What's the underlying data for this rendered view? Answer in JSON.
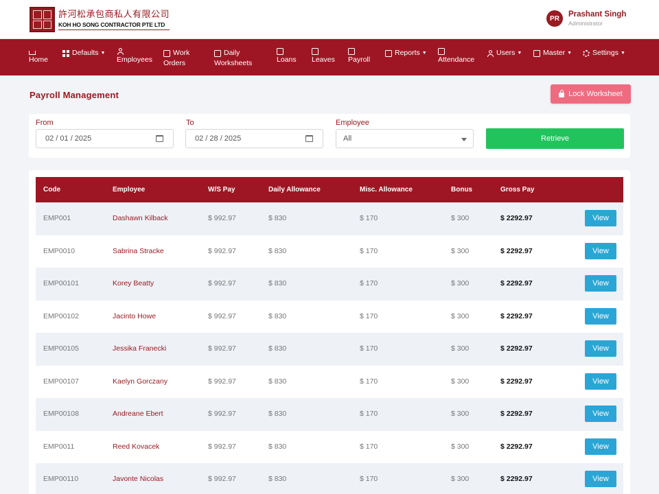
{
  "brand": {
    "name_cn": "許河松承包商私人有限公司",
    "name_en": "KOH HO SONG CONTRACTOR PTE LTD"
  },
  "user": {
    "initials": "PR",
    "name": "Prashant Singh",
    "role": "Administrator"
  },
  "nav": {
    "items": [
      {
        "line1": "Home",
        "line2": "",
        "icon": "home-icon"
      },
      {
        "line1": "Defaults",
        "line2": "",
        "icon": "grid-icon",
        "dropdown": true
      },
      {
        "line1": "",
        "line2": "Employees",
        "icon": "person-icon"
      },
      {
        "line1": "Work",
        "line2": "Orders",
        "icon": "briefcase-icon"
      },
      {
        "line1": "Daily",
        "line2": "Worksheets",
        "icon": "calendar-icon"
      },
      {
        "line1": "",
        "line2": "Loans",
        "icon": "money-icon"
      },
      {
        "line1": "",
        "line2": "Leaves",
        "icon": "calendar-icon"
      },
      {
        "line1": "",
        "line2": "Payroll",
        "icon": "payroll-icon"
      },
      {
        "line1": "Reports",
        "line2": "",
        "icon": "report-icon",
        "dropdown": true
      },
      {
        "line1": "",
        "line2": "Attendance",
        "icon": "attendance-icon"
      },
      {
        "line1": "Users",
        "line2": "",
        "icon": "users-icon",
        "dropdown": true
      },
      {
        "line1": "Master",
        "line2": "",
        "icon": "database-icon",
        "dropdown": true
      },
      {
        "line1": "Settings",
        "line2": "",
        "icon": "gear-icon",
        "dropdown": true
      }
    ]
  },
  "page": {
    "title": "Payroll Management",
    "lock_button": "Lock Worksheet"
  },
  "filters": {
    "from_label": "From",
    "from_value": "02 / 01 / 2025",
    "to_label": "To",
    "to_value": "02 / 28 / 2025",
    "employee_label": "Employee",
    "employee_value": "All",
    "retrieve_button": "Retrieve"
  },
  "table": {
    "headers": [
      "Code",
      "Employee",
      "W/S Pay",
      "Daily Allowance",
      "Misc. Allowance",
      "Bonus",
      "Gross Pay"
    ],
    "view_label": "View",
    "rows": [
      {
        "code": "EMP001",
        "name": "Dashawn Kilback",
        "ws_pay": "$ 992.97",
        "daily": "$ 830",
        "misc": "$ 170",
        "bonus": "$ 300",
        "gross": "$ 2292.97"
      },
      {
        "code": "EMP0010",
        "name": "Sabrina Stracke",
        "ws_pay": "$ 992.97",
        "daily": "$ 830",
        "misc": "$ 170",
        "bonus": "$ 300",
        "gross": "$ 2292.97"
      },
      {
        "code": "EMP00101",
        "name": "Korey Beatty",
        "ws_pay": "$ 992.97",
        "daily": "$ 830",
        "misc": "$ 170",
        "bonus": "$ 300",
        "gross": "$ 2292.97"
      },
      {
        "code": "EMP00102",
        "name": "Jacinto Howe",
        "ws_pay": "$ 992.97",
        "daily": "$ 830",
        "misc": "$ 170",
        "bonus": "$ 300",
        "gross": "$ 2292.97"
      },
      {
        "code": "EMP00105",
        "name": "Jessika Franecki",
        "ws_pay": "$ 992.97",
        "daily": "$ 830",
        "misc": "$ 170",
        "bonus": "$ 300",
        "gross": "$ 2292.97"
      },
      {
        "code": "EMP00107",
        "name": "Kaelyn Gorczany",
        "ws_pay": "$ 992.97",
        "daily": "$ 830",
        "misc": "$ 170",
        "bonus": "$ 300",
        "gross": "$ 2292.97"
      },
      {
        "code": "EMP00108",
        "name": "Andreane Ebert",
        "ws_pay": "$ 992.97",
        "daily": "$ 830",
        "misc": "$ 170",
        "bonus": "$ 300",
        "gross": "$ 2292.97"
      },
      {
        "code": "EMP0011",
        "name": "Reed Kovacek",
        "ws_pay": "$ 992.97",
        "daily": "$ 830",
        "misc": "$ 170",
        "bonus": "$ 300",
        "gross": "$ 2292.97"
      },
      {
        "code": "EMP00110",
        "name": "Javonte Nicolas",
        "ws_pay": "$ 992.97",
        "daily": "$ 830",
        "misc": "$ 170",
        "bonus": "$ 300",
        "gross": "$ 2292.97"
      }
    ]
  },
  "colors": {
    "brand_red": "#9e1624",
    "lock_pink": "#ee6b80",
    "retrieve_green": "#22c35d",
    "view_blue": "#2aa6d6"
  }
}
